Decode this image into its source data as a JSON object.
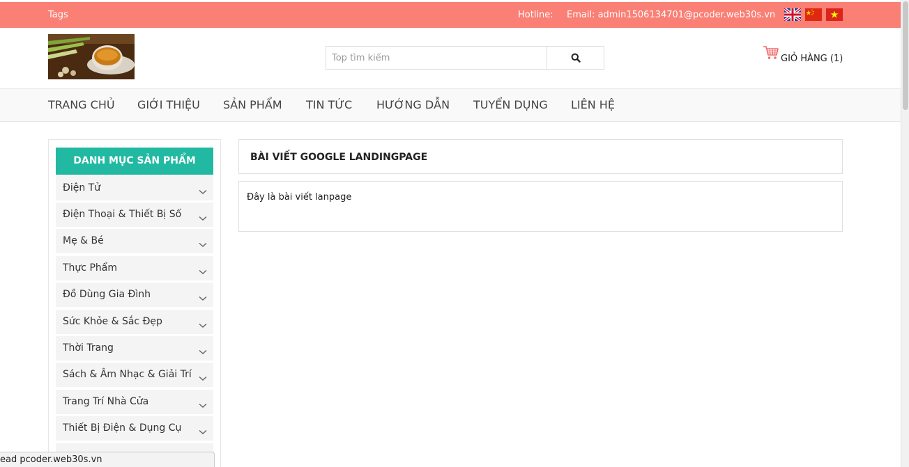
{
  "topbar": {
    "tags": "Tags",
    "hotline": "Hotline:",
    "email": "Email: admin1506134701@pcoder.web30s.vn",
    "flags": [
      "uk-flag-icon",
      "china-flag-icon",
      "vietnam-flag-icon"
    ]
  },
  "search": {
    "placeholder": "Top tìm kiếm",
    "value": "",
    "icon": "search-icon"
  },
  "cart": {
    "label": "GIỎ HÀNG (1)",
    "icon": "cart-icon"
  },
  "nav": {
    "items": [
      "TRANG CHỦ",
      "GIỚI THIỆU",
      "SẢN PHẨM",
      "TIN TỨC",
      "HƯỚNG DẪN",
      "TUYỂN DỤNG",
      "LIÊN HỆ"
    ]
  },
  "sidebar": {
    "title": "DANH MỤC SẢN PHẨM",
    "items": [
      "Điện Tử",
      "Điện Thoại & Thiết Bị Số",
      "Mẹ & Bé",
      "Thực Phẩm",
      "Đồ Dùng Gia Đình",
      "Sức Khỏe & Sắc Đẹp",
      "Thời Trang",
      "Sách & Âm Nhạc & Giải Trí",
      "Trang Trí Nhà Cửa",
      "Thiết Bị Điện & Dụng Cụ"
    ]
  },
  "post": {
    "title": "BÀI VIẾT GOOGLE LANDINGPAGE",
    "content": "Đây là bài viết lanpage"
  },
  "status": {
    "text": "ead pcoder.web30s.vn"
  },
  "colors": {
    "topbar": "#fa7f75",
    "accent": "#21b9a1",
    "cart": "#f06a6a"
  }
}
